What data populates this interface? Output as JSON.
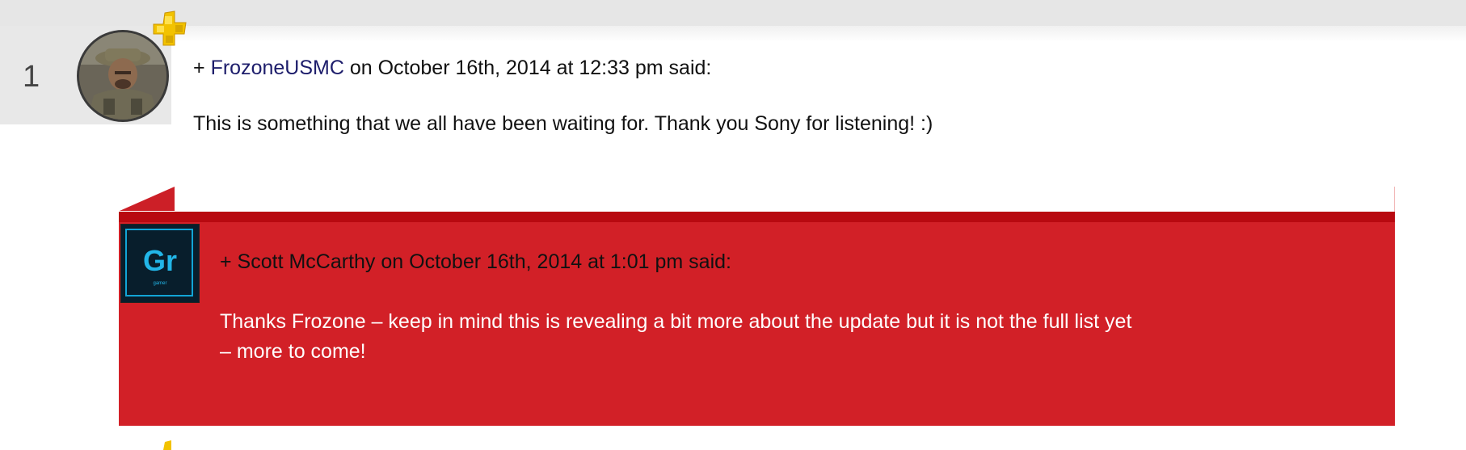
{
  "comment": {
    "number": "1",
    "prefix": "+",
    "author": "FrozoneUSMC",
    "meta_suffix": " on October 16th, 2014 at 12:33 pm said:",
    "body": "This is something that we all have been waiting for. Thank you Sony for listening! :)"
  },
  "reply": {
    "prefix": "+",
    "meta": " Scott McCarthy on October 16th, 2014 at 1:01 pm said:",
    "avatar_text": "Gr",
    "avatar_subtext": "gamer",
    "body_line1": "Thanks Frozone – keep in mind this is revealing a bit more about the update but it is not the full list yet",
    "body_line2": "– more to come!"
  },
  "colors": {
    "reply_background": "#d22027",
    "reply_topbar": "#b80910",
    "author_link": "#1d1d6b",
    "ps_plus_gold": "#f2c200"
  },
  "icons": {
    "badge": "playstation-plus-icon"
  }
}
